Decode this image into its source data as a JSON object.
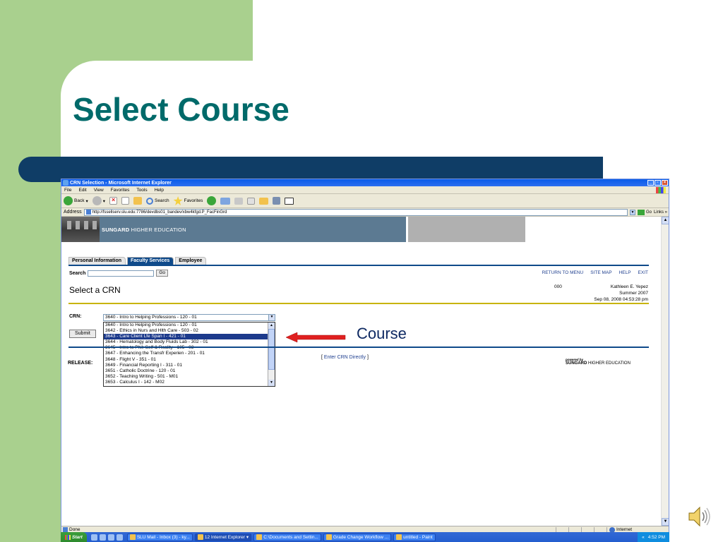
{
  "slide": {
    "title": "Select Course",
    "annotation": "Course"
  },
  "browser": {
    "window_title": "CRN Selection - Microsoft Internet Explorer",
    "menu": [
      "File",
      "Edit",
      "View",
      "Favorites",
      "Tools",
      "Help"
    ],
    "toolbar": {
      "back": "Back",
      "search": "Search",
      "favorites": "Favorites"
    },
    "address_label": "Address",
    "url": "http://fssellserv.slu.edu:7786/devdbs01_bandev/xbw4kfgd.P_FacFinGrd",
    "go": "Go",
    "links": "Links",
    "status": "Done",
    "zone": "Internet"
  },
  "banner": {
    "brand": "SUNGARD",
    "tagline": "HIGHER EDUCATION"
  },
  "tabs": [
    {
      "label": "Personal Information",
      "active": false
    },
    {
      "label": "Faculty Services",
      "active": true
    },
    {
      "label": "Employee",
      "active": false
    }
  ],
  "search": {
    "label": "Search",
    "value": "",
    "go": "Go"
  },
  "top_links": [
    "RETURN TO MENU",
    "SITE MAP",
    "HELP",
    "EXIT"
  ],
  "page": {
    "heading": "Select a CRN",
    "user_code": "000",
    "user_name": "Kathleen E. Yepez",
    "term": "Summer 2007",
    "datetime": "Sep 08, 2008 04:53:28 pm"
  },
  "crn": {
    "label": "CRN:",
    "selected": "3640 - Intro to Helping Professions - 120 - 01",
    "options": [
      "3640 - Intro to Helping Professions - 120 - 01",
      "3642 - Ethics in Nurs and Hlth Care - 503 - 02",
      "3643 - Care Client Lfe Span I - 421 - 01",
      "3644 - Hematology and Body Fluids Lab - 302 - 01",
      "3645 - Intro to Phil: Self & Reality - 105 - 03",
      "3647 - Enhancing the Transfr Experien - 201 - 01",
      "3648 - Flight V - 351 - 01",
      "3649 - Financial Reporting I - 311 - 01",
      "3651 - Catholic Doctrine - 120 - 01",
      "3652 - Teaching Writing - 501 - M01",
      "3653 - Calculus I - 142 - M02"
    ],
    "highlighted_index": 2
  },
  "submit": "Submit",
  "release_label": "RELEASE:",
  "enter_crn": "Enter CRN Directly",
  "powered_by": {
    "small": "powered by",
    "brand": "SUNGARD",
    "tag": "HIGHER EDUCATION"
  },
  "taskbar": {
    "start": "Start",
    "tasks": [
      "SLU Mail - Inbox (3) - ky...",
      "12 Internet Explorer",
      "C:\\Documents and Settin...",
      "Grade Change Workflow ...",
      "untitled - Paint"
    ],
    "active_task_index": 1,
    "clock": "4:52 PM"
  },
  "colors": {
    "slide_green": "#a9d08e",
    "title_teal": "#006a6a",
    "bar_navy": "#0f3d66",
    "arrow_red": "#e02020"
  }
}
